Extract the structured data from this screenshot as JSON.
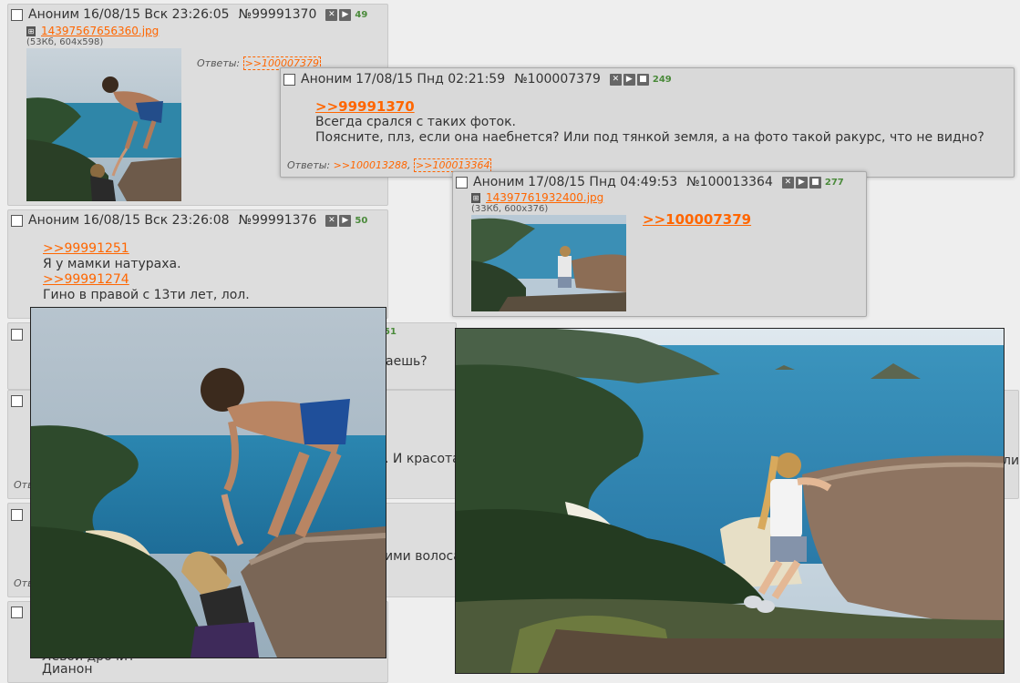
{
  "posts": {
    "p1": {
      "author": "Аноним",
      "date": "16/08/15 Вск 23:26:05",
      "num": "№99991370",
      "count": "49",
      "file_name": "14397567656360.jpg",
      "file_meta": "(53Кб, 604x598)",
      "replies_label": "Ответы:",
      "replies": [
        ">>100007379"
      ]
    },
    "p2": {
      "author": "Аноним",
      "date": "17/08/15 Пнд 02:21:59",
      "num": "№100007379",
      "count": "249",
      "quote": ">>99991370",
      "lines": [
        "Всегда срался с таких фоток.",
        "Поясните, плз, если она наебнется? Или под тянкой земля, а на фото такой ракурс, что не видно?"
      ],
      "replies_label": "Ответы:",
      "replies": [
        ">>100013288",
        ">>100013364"
      ]
    },
    "p3": {
      "author": "Аноним",
      "date": "17/08/15 Пнд 04:49:53",
      "num": "№100013364",
      "count": "277",
      "file_name": "14397761932400.jpg",
      "file_meta": "(33Кб, 600x376)",
      "quote": ">>100007379"
    },
    "p4": {
      "author": "Аноним",
      "date": "16/08/15 Вск 23:26:08",
      "num": "№99991376",
      "count": "50",
      "lines": [
        {
          "text": ">>99991251",
          "link": true
        },
        {
          "text": "Я у мамки натураха.",
          "link": false
        },
        {
          "text": ">>99991274",
          "link": true
        },
        {
          "text": "Гино в правой с 13ти лет, лол.",
          "link": false
        }
      ]
    }
  },
  "fragments": {
    "f1": "51",
    "f2": "аешь?",
    "f3": ". И красота",
    "f4": "ли",
    "f5": "ими волоса",
    "f6": "Отв",
    "f7": "Отв",
    "f8": "Левой дрочит",
    "f9": "Дианон"
  },
  "colors": {
    "link": "#ff6600",
    "post_bg": "#dddddd",
    "page_bg": "#eeeeee",
    "count": "#4a8a3a"
  }
}
